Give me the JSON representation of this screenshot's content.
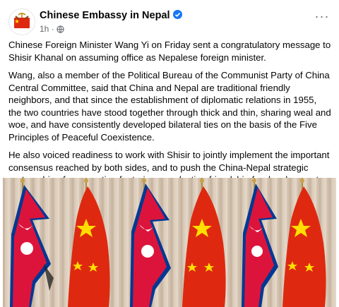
{
  "post": {
    "page_name": "Chinese Embassy in Nepal",
    "time": "1h",
    "separator": "·",
    "audience_icon": "globe-icon",
    "verified_icon": "verified-badge-icon",
    "more_icon": "more-options-icon",
    "paragraphs": [
      "Chinese Foreign Minister Wang Yi on Friday sent a congratulatory message to Shisir Khanal on assuming office as Nepalese foreign minister.",
      "Wang, also a member of the Political Bureau of the Communist Party of China Central Committee, said that China and Nepal are traditional friendly neighbors, and that since the establishment of diplomatic relations in 1955, the two countries have stood together through thick and thin, sharing weal and woe, and have consistently developed bilateral ties on the basis of the Five Principles of Peaceful Coexistence.",
      "He also voiced readiness to work with Shisir to jointly implement the important consensus reached by both sides, and to push the China-Nepal strategic partnership of cooperation featuring ever-lasting friendship for development and prosperity to achieve new progress."
    ],
    "photo": {
      "subject": "alternating Nepalese and Chinese flags",
      "colors": {
        "curtain": "#d9c9b8",
        "nepal_red": "#dc143c",
        "nepal_blue": "#003893",
        "china_red": "#de2910",
        "china_yellow": "#ffde00"
      }
    }
  }
}
